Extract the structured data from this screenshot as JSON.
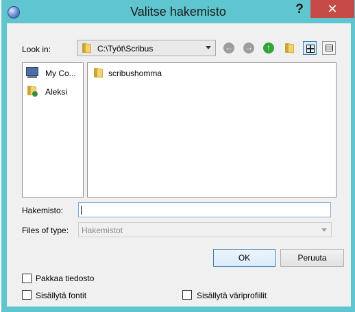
{
  "window": {
    "title": "Valitse hakemisto",
    "help_label": "?",
    "close_label": "✕"
  },
  "lookin": {
    "label": "Look in:",
    "path": "C:\\Työt\\Scribus"
  },
  "toolbar": {
    "icons": [
      "back-icon",
      "forward-icon",
      "parent-dir-icon",
      "new-folder-icon",
      "list-view-icon",
      "detail-view-icon"
    ]
  },
  "sidebar": {
    "items": [
      {
        "label": "My Co...",
        "icon": "computer-icon"
      },
      {
        "label": "Aleksi",
        "icon": "user-folder-icon"
      }
    ]
  },
  "files": {
    "items": [
      {
        "label": "scribushomma",
        "icon": "folder-icon"
      }
    ]
  },
  "filename": {
    "label": "Hakemisto:",
    "value": ""
  },
  "filetype": {
    "label": "Files of type:",
    "value": "Hakemistot"
  },
  "buttons": {
    "ok": "OK",
    "cancel": "Peruuta"
  },
  "options": {
    "compress": "Pakkaa tiedosto",
    "include_fonts": "Sisällytä fontit",
    "include_profiles": "Sisällytä väriprofiilit"
  },
  "colors": {
    "titlebar": "#5fc6cf",
    "close": "#c64a46",
    "dialog_bg": "#f0f0f0"
  }
}
